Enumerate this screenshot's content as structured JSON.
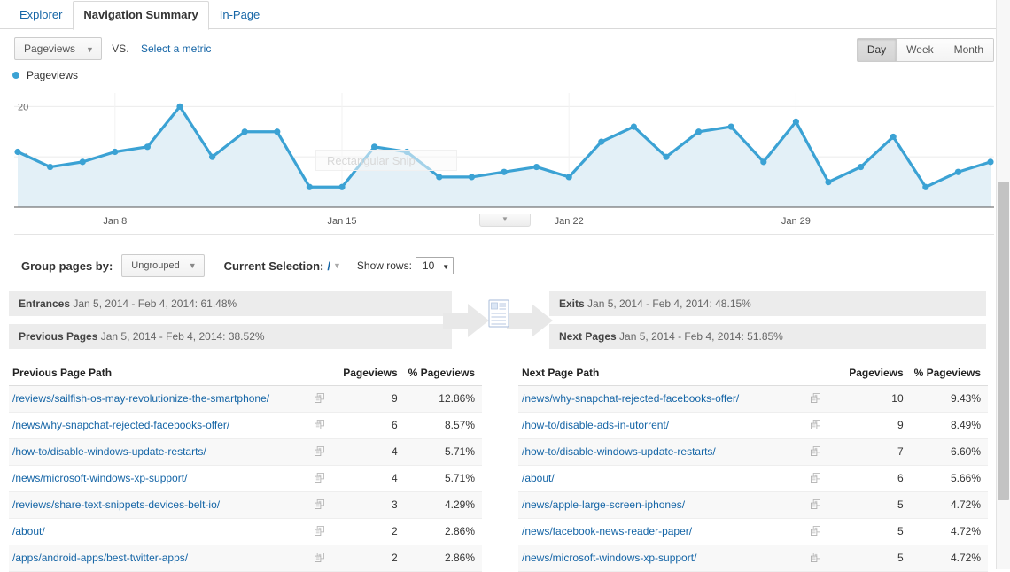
{
  "tabs": [
    {
      "label": "Explorer",
      "active": false
    },
    {
      "label": "Navigation Summary",
      "active": true
    },
    {
      "label": "In-Page",
      "active": false
    }
  ],
  "metric_row": {
    "selected_metric": "Pageviews",
    "vs_label": "VS.",
    "select_metric_link": "Select a metric",
    "caret": "▼"
  },
  "time_granularity": {
    "options": [
      "Day",
      "Week",
      "Month"
    ],
    "selected": "Day"
  },
  "legend": {
    "series_label": "Pageviews",
    "color": "#3ba2d4"
  },
  "watermark": "Rectangular Snip",
  "controls": {
    "group_pages_by_label": "Group pages by:",
    "group_pages_by_value": "Ungrouped",
    "current_selection_label": "Current Selection:",
    "current_selection_value": "/",
    "show_rows_label": "Show rows:",
    "show_rows_value": "10",
    "caret": "▼"
  },
  "summary": {
    "entrances": {
      "label": "Entrances",
      "text": "Jan 5, 2014 - Feb 4, 2014: 61.48%"
    },
    "previous_pages": {
      "label": "Previous Pages",
      "text": "Jan 5, 2014 - Feb 4, 2014: 38.52%"
    },
    "exits": {
      "label": "Exits",
      "text": "Jan 5, 2014 - Feb 4, 2014: 48.15%"
    },
    "next_pages": {
      "label": "Next Pages",
      "text": "Jan 5, 2014 - Feb 4, 2014: 51.85%"
    }
  },
  "previous_table": {
    "headers": [
      "Previous Page Path",
      "Pageviews",
      "% Pageviews"
    ],
    "rows": [
      {
        "path": "/reviews/sailfish-os-may-revolutionize-the-smartphone/",
        "pageviews": "9",
        "pct": "12.86%"
      },
      {
        "path": "/news/why-snapchat-rejected-facebooks-offer/",
        "pageviews": "6",
        "pct": "8.57%"
      },
      {
        "path": "/how-to/disable-windows-update-restarts/",
        "pageviews": "4",
        "pct": "5.71%"
      },
      {
        "path": "/news/microsoft-windows-xp-support/",
        "pageviews": "4",
        "pct": "5.71%"
      },
      {
        "path": "/reviews/share-text-snippets-devices-belt-io/",
        "pageviews": "3",
        "pct": "4.29%"
      },
      {
        "path": "/about/",
        "pageviews": "2",
        "pct": "2.86%"
      },
      {
        "path": "/apps/android-apps/best-twitter-apps/",
        "pageviews": "2",
        "pct": "2.86%"
      }
    ]
  },
  "next_table": {
    "headers": [
      "Next Page Path",
      "Pageviews",
      "% Pageviews"
    ],
    "rows": [
      {
        "path": "/news/why-snapchat-rejected-facebooks-offer/",
        "pageviews": "10",
        "pct": "9.43%"
      },
      {
        "path": "/how-to/disable-ads-in-utorrent/",
        "pageviews": "9",
        "pct": "8.49%"
      },
      {
        "path": "/how-to/disable-windows-update-restarts/",
        "pageviews": "7",
        "pct": "6.60%"
      },
      {
        "path": "/about/",
        "pageviews": "6",
        "pct": "5.66%"
      },
      {
        "path": "/news/apple-large-screen-iphones/",
        "pageviews": "5",
        "pct": "4.72%"
      },
      {
        "path": "/news/facebook-news-reader-paper/",
        "pageviews": "5",
        "pct": "4.72%"
      },
      {
        "path": "/news/microsoft-windows-xp-support/",
        "pageviews": "5",
        "pct": "4.72%"
      }
    ]
  },
  "chart_data": {
    "type": "line",
    "title": "",
    "xlabel": "",
    "ylabel": "Pageviews",
    "ylim": [
      0,
      22
    ],
    "yticks": [
      10,
      20
    ],
    "grid": true,
    "legend_position": "top-left",
    "tick_labels": [
      "Jan 8",
      "Jan 15",
      "Jan 22",
      "Jan 29"
    ],
    "tick_indices": [
      3,
      10,
      17,
      24
    ],
    "x": [
      "Jan 5",
      "Jan 6",
      "Jan 7",
      "Jan 8",
      "Jan 9",
      "Jan 10",
      "Jan 11",
      "Jan 12",
      "Jan 13",
      "Jan 14",
      "Jan 15",
      "Jan 16",
      "Jan 17",
      "Jan 18",
      "Jan 19",
      "Jan 20",
      "Jan 21",
      "Jan 22",
      "Jan 23",
      "Jan 24",
      "Jan 25",
      "Jan 26",
      "Jan 27",
      "Jan 28",
      "Jan 29",
      "Jan 30",
      "Jan 31",
      "Feb 1",
      "Feb 2",
      "Feb 3",
      "Feb 4"
    ],
    "series": [
      {
        "name": "Pageviews",
        "color": "#3ba2d4",
        "values": [
          11,
          8,
          9,
          11,
          12,
          20,
          10,
          15,
          15,
          4,
          4,
          12,
          11,
          6,
          6,
          7,
          8,
          6,
          13,
          16,
          10,
          15,
          16,
          9,
          17,
          5,
          8,
          14,
          4,
          7,
          9
        ]
      }
    ]
  }
}
